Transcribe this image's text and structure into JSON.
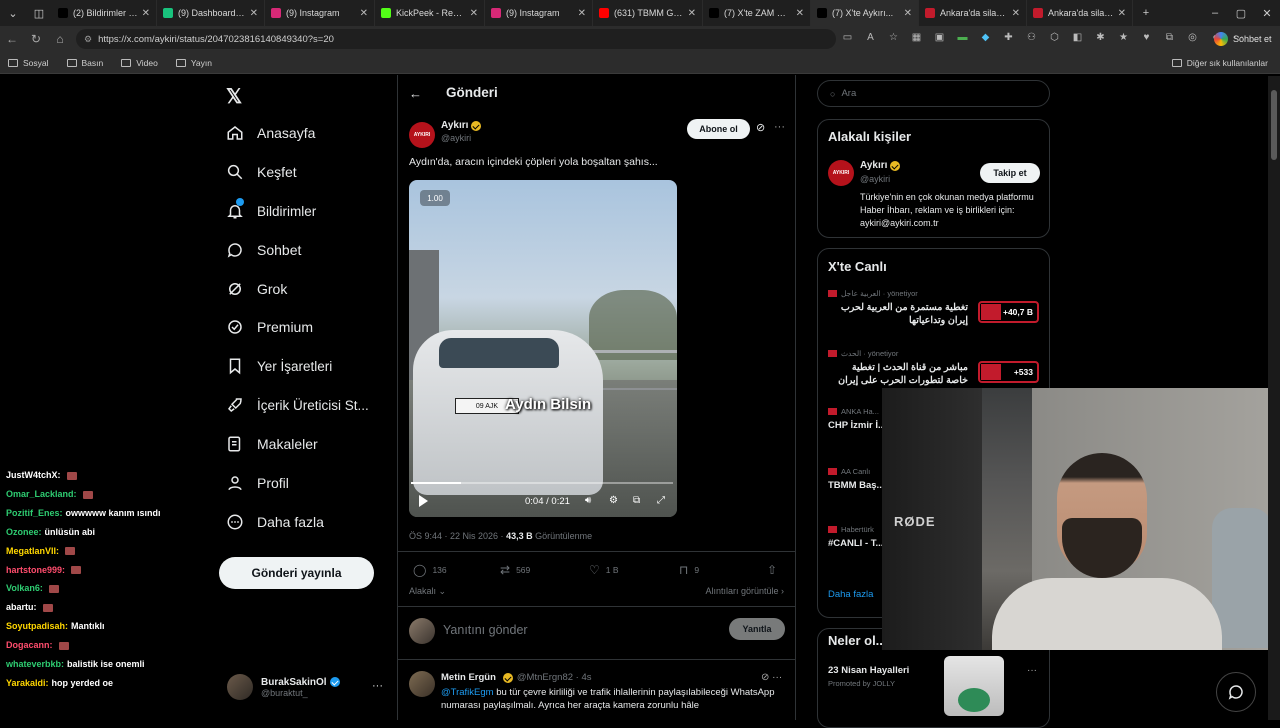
{
  "browser": {
    "tabs": [
      {
        "label": "(2) Bildirimler / X",
        "color": "#000000",
        "width": 105
      },
      {
        "label": "(9) Dashboard / Str...",
        "color": "#19c37d",
        "width": 108
      },
      {
        "label": "(9) Instagram",
        "color": "#d62976",
        "width": 110
      },
      {
        "label": "KickPeek - Real-tim...",
        "color": "#53fc18",
        "width": 110
      },
      {
        "label": "(9) Instagram",
        "color": "#d62976",
        "width": 108
      },
      {
        "label": "(631) TBMM Genel ...",
        "color": "#ff0000",
        "width": 110
      },
      {
        "label": "(7) X'te ZAM Haber...",
        "color": "#000000",
        "width": 108
      },
      {
        "label": "(7) X'te Aykırı...",
        "color": "#000000",
        "width": 108
      },
      {
        "label": "Ankara'da silahlı öğ...",
        "color": "#c21b2c",
        "width": 108
      },
      {
        "label": "Ankara'da silahlı öğ...",
        "color": "#c21b2c",
        "width": 106
      }
    ],
    "url": "https://x.com/aykiri/status/2047023816140849340?s=20",
    "sohbet_label": "Sohbet et",
    "bookmarks": [
      "Sosyal",
      "Basın",
      "Video",
      "Yayın"
    ],
    "bookmarks_right": "Diğer sık kullanılanlar"
  },
  "nav": {
    "items": [
      "Anasayfa",
      "Keşfet",
      "Bildirimler",
      "Sohbet",
      "Grok",
      "Premium",
      "Yer İşaretleri",
      "İçerik Üreticisi St...",
      "Makaleler",
      "Profil",
      "Daha fazla"
    ],
    "icons": [
      "home-icon",
      "search-icon",
      "bell-icon",
      "chat-icon",
      "grok-icon",
      "premium-icon",
      "bookmark-icon",
      "rocket-icon",
      "article-icon",
      "person-icon",
      "more-circle-icon"
    ],
    "post_button": "Gönderi yayınla",
    "account_name": "BurakSakinOl",
    "account_handle": "@buraktut_"
  },
  "chat": [
    {
      "user": "JustW4tchX:",
      "msg": "",
      "color": "#ffffff"
    },
    {
      "user": "Omar_Lackland:",
      "msg": "",
      "color": "#2ecc71"
    },
    {
      "user": "Pozitif_Enes:",
      "msg": "owwwww kanım ısındı",
      "color": "#2ecc71"
    },
    {
      "user": "Ozonee:",
      "msg": "ünlüsün abi",
      "color": "#2ecc71"
    },
    {
      "user": "MegatlanVII:",
      "msg": "",
      "color": "#ffd700"
    },
    {
      "user": "hartstone999:",
      "msg": "",
      "color": "#ff4d6d"
    },
    {
      "user": "Volkan6:",
      "msg": "",
      "color": "#2ecc71"
    },
    {
      "user": "abartu:",
      "msg": "",
      "color": "#ffffff"
    },
    {
      "user": "Soyutpadisah:",
      "msg": "Mantıklı",
      "color": "#ffd700"
    },
    {
      "user": "Dogacann:",
      "msg": "",
      "color": "#ff4d6d"
    },
    {
      "user": "whateverbkb:",
      "msg": "balistik ise onemli",
      "color": "#2ecc71"
    },
    {
      "user": "Yarakaldi:",
      "msg": "hop yerded oe",
      "color": "#ffd700"
    }
  ],
  "post": {
    "header_title": "Gönderi",
    "author": "Aykırı",
    "handle": "@aykiri",
    "avatar_text": "AYKIRI",
    "subscribe": "Abone ol",
    "text": "Aydın'da, aracın içindeki çöpleri yola boşaltan şahıs...",
    "video": {
      "speed": "1.00",
      "caption": "Aydın Bilsin",
      "plate": "09 AJK",
      "time": "0:04 / 0:21",
      "progress": 0.19
    },
    "timestamp": "ÖS 9:44 · 22 Nis 2026 · ",
    "views": "43,3 B",
    "views_label": " Görüntülenme",
    "stats": {
      "replies": "136",
      "reposts": "569",
      "likes": "1 B",
      "bookmarks": "9"
    },
    "relevance": "Alakalı",
    "quotes": "Alıntıları görüntüle",
    "reply_placeholder": "Yanıtını gönder",
    "reply_button": "Yanıtla"
  },
  "comment": {
    "name": "Metin Ergün",
    "handle": "@MtnErgn82 · 4s",
    "mention": "@TrafikEgm",
    "text": " bu tür çevre kirliliği ve trafik ihlallerinin paylaşılabileceği WhatsApp numarası paylaşılmalı. Ayrıca her araçta kamera zorunlu hâle"
  },
  "right": {
    "search_placeholder": "Ara",
    "related_title": "Alakalı kişiler",
    "related_name": "Aykırı",
    "related_handle": "@aykiri",
    "follow": "Takip et",
    "related_bio": "Türkiye'nin en çok okunan medya platformu Haber İhbarı, reklam ve iş birlikleri için: aykiri@aykiri.com.tr",
    "live_title": "X'te Canlı",
    "live": [
      {
        "source": "العربية عاجل · yönetiyor",
        "title": "تغطية مستمرة من العربية لحرب إيران وتداعياتها",
        "count": "+40,7 B"
      },
      {
        "source": "الحدث · yönetiyor",
        "title": "مباشر من قناة الحدث | تغطية خاصة لتطورات الحرب على إيران لحظة",
        "count": "+533"
      },
      {
        "source": "ANKA Ha...",
        "title": "CHP İzmir İ... Millî Eğitim...",
        "count": ""
      },
      {
        "source": "AA Canlı",
        "title": "TBMM Baş... Kurtulmuş...",
        "count": ""
      },
      {
        "source": "Habertürk",
        "title": "#CANLI - T... Özel Oturu...",
        "count": ""
      }
    ],
    "more": "Daha fazla",
    "trends_title": "Neler ol...",
    "trend_name": "23 Nisan Hayalleri",
    "trend_sub": "Promoted by JOLLY"
  },
  "webcam": {
    "brand": "RØDE"
  }
}
